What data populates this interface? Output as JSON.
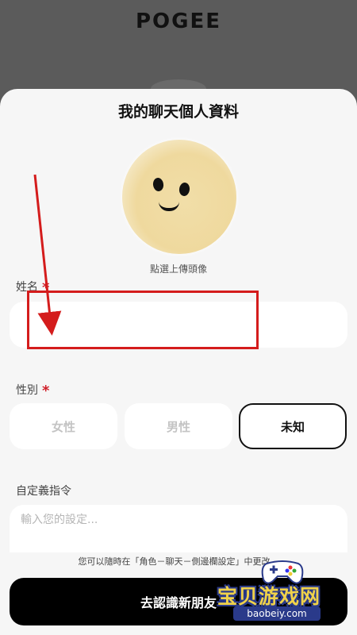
{
  "header": {
    "logo": "POGEE"
  },
  "profile": {
    "title": "我的聊天個人資料",
    "avatar_caption": "點選上傳頭像",
    "name": {
      "label": "姓名",
      "required_mark": "*",
      "value": ""
    },
    "gender": {
      "label": "性別",
      "required_mark": "*",
      "options": [
        "女性",
        "男性",
        "未知"
      ],
      "selected": "未知"
    },
    "custom_command": {
      "label": "自定義指令",
      "placeholder": "輸入您的設定..."
    },
    "hint": "您可以隨時在「角色－聊天－側邊欄設定」中更改。",
    "submit_label": "去認識新朋友"
  },
  "annotation_color": "#d41c1c",
  "watermark": {
    "text": "宝贝游戏网",
    "url": "baobeiy.com"
  }
}
